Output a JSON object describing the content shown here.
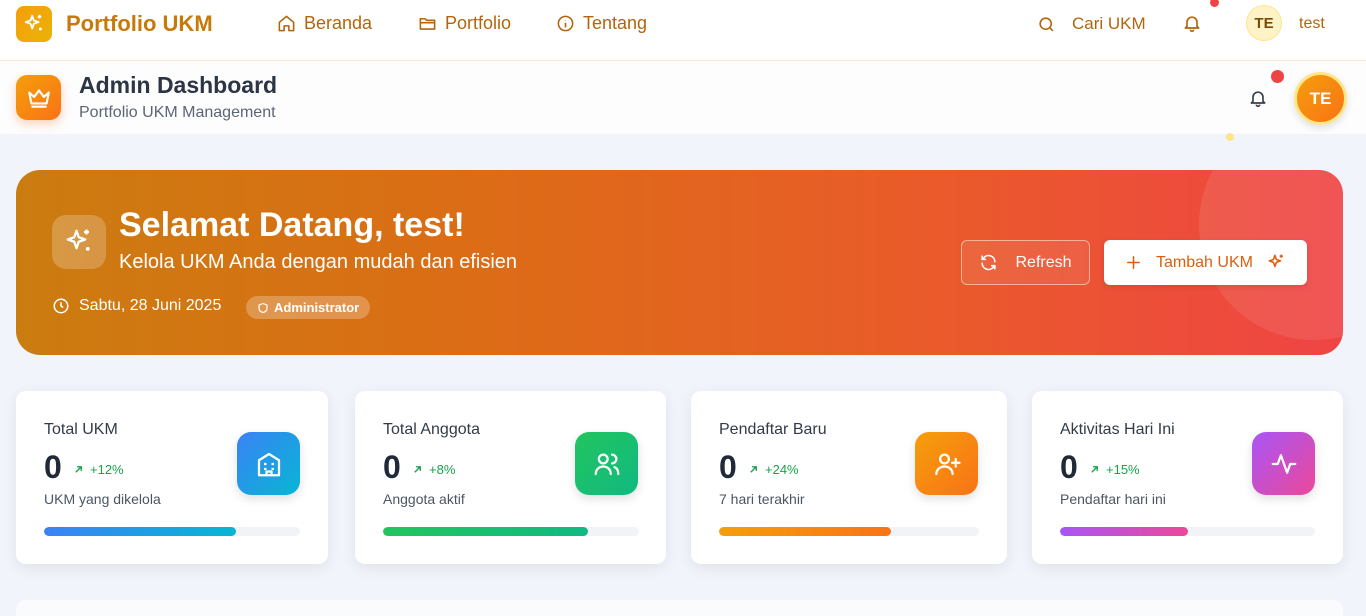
{
  "topnav": {
    "brand": "Portfolio UKM",
    "links": [
      {
        "label": "Beranda",
        "icon": "home-icon"
      },
      {
        "label": "Portfolio",
        "icon": "folder-icon"
      },
      {
        "label": "Tentang",
        "icon": "info-icon"
      }
    ],
    "search_label": "Cari UKM",
    "avatar_initials": "TE",
    "username": "test"
  },
  "admin_header": {
    "title": "Admin Dashboard",
    "subtitle": "Portfolio UKM Management",
    "avatar_initials": "TE"
  },
  "hero": {
    "title": "Selamat Datang, test!",
    "subtitle": "Kelola UKM Anda dengan mudah dan efisien",
    "date": "Sabtu, 28 Juni 2025",
    "role_badge": "Administrator",
    "refresh_label": "Refresh",
    "add_label": "Tambah UKM"
  },
  "stats": [
    {
      "label": "Total UKM",
      "value": "0",
      "trend": "+12%",
      "desc": "UKM yang dikelola",
      "icon": "building-icon",
      "progress": 0.75,
      "color_from": "#3b82f6",
      "color_to": "#06b6d4"
    },
    {
      "label": "Total Anggota",
      "value": "0",
      "trend": "+8%",
      "desc": "Anggota aktif",
      "icon": "users-icon",
      "progress": 0.8,
      "color_from": "#22c55e",
      "color_to": "#10b981"
    },
    {
      "label": "Pendaftar Baru",
      "value": "0",
      "trend": "+24%",
      "desc": "7 hari terakhir",
      "icon": "user-plus-icon",
      "progress": 0.66,
      "color_from": "#f59e0b",
      "color_to": "#f97316"
    },
    {
      "label": "Aktivitas Hari Ini",
      "value": "0",
      "trend": "+15%",
      "desc": "Pendaftar hari ini",
      "icon": "activity-icon",
      "progress": 0.5,
      "color_from": "#a855f7",
      "color_to": "#ec4899"
    }
  ],
  "colors": {
    "brand": "#c77a0a",
    "accent_orange": "#f97316",
    "notification_dot": "#ef4444",
    "trend_up": "#16a34a"
  }
}
